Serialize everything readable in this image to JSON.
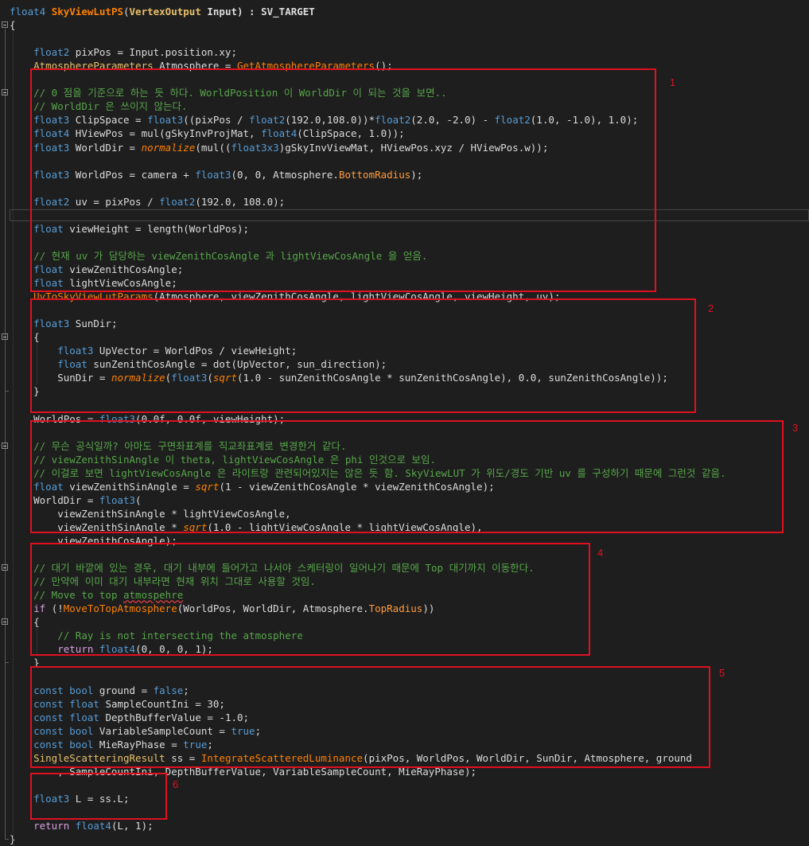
{
  "editor": {
    "lines": [
      {
        "spans": [
          [
            "float4",
            "type"
          ],
          [
            " ",
            ""
          ],
          [
            "SkyViewLutPS",
            "fn"
          ],
          [
            "(",
            ""
          ],
          [
            "VertexOutput",
            "struct"
          ],
          [
            " Input) : SV_TARGET",
            ""
          ]
        ]
      },
      {
        "spans": [
          [
            "{",
            ""
          ]
        ]
      },
      {
        "spans": [
          [
            "",
            ""
          ]
        ]
      },
      {
        "spans": [
          [
            "    ",
            ""
          ],
          [
            "float2",
            "type"
          ],
          [
            " pixPos = Input.position.xy;",
            ""
          ]
        ]
      },
      {
        "spans": [
          [
            "    ",
            ""
          ],
          [
            "AtmosphereParameters",
            "struct"
          ],
          [
            " Atmosphere = ",
            ""
          ],
          [
            "GetAtmosphereParameters",
            "fn"
          ],
          [
            "();",
            ""
          ]
        ]
      },
      {
        "spans": [
          [
            "",
            ""
          ]
        ]
      },
      {
        "spans": [
          [
            "    ",
            ""
          ],
          [
            "// 0 점을 기준으로 하는 듯 하다. WorldPosition 이 WorldDir 이 되는 것을 보면..",
            "cmt"
          ]
        ]
      },
      {
        "spans": [
          [
            "    ",
            ""
          ],
          [
            "// WorldDir 은 쓰이지 않는다.",
            "cmt"
          ]
        ]
      },
      {
        "spans": [
          [
            "    ",
            ""
          ],
          [
            "float3",
            "type"
          ],
          [
            " ClipSpace = ",
            ""
          ],
          [
            "float3",
            "type"
          ],
          [
            "((pixPos / ",
            ""
          ],
          [
            "float2",
            "type"
          ],
          [
            "(192.0,108.0))*",
            ""
          ],
          [
            "float2",
            "type"
          ],
          [
            "(2.0, -2.0) - ",
            ""
          ],
          [
            "float2",
            "type"
          ],
          [
            "(1.0, -1.0), 1.0);",
            ""
          ]
        ]
      },
      {
        "spans": [
          [
            "    ",
            ""
          ],
          [
            "float4",
            "type"
          ],
          [
            " HViewPos = mul(gSkyInvProjMat, ",
            ""
          ],
          [
            "float4",
            "type"
          ],
          [
            "(ClipSpace, 1.0));",
            ""
          ]
        ]
      },
      {
        "spans": [
          [
            "    ",
            ""
          ],
          [
            "float3",
            "type"
          ],
          [
            " WorldDir = ",
            ""
          ],
          [
            "normalize",
            "ital"
          ],
          [
            "(mul((",
            ""
          ],
          [
            "float3x3",
            "type"
          ],
          [
            ")gSkyInvViewMat, HViewPos.xyz / HViewPos.w));",
            ""
          ]
        ]
      },
      {
        "spans": [
          [
            "",
            ""
          ]
        ]
      },
      {
        "spans": [
          [
            "    ",
            ""
          ],
          [
            "float3",
            "type"
          ],
          [
            " WorldPos = camera + ",
            ""
          ],
          [
            "float3",
            "type"
          ],
          [
            "(0, 0, Atmosphere.",
            ""
          ],
          [
            "BottomRadius",
            "field"
          ],
          [
            ");",
            ""
          ]
        ]
      },
      {
        "spans": [
          [
            "",
            ""
          ]
        ]
      },
      {
        "spans": [
          [
            "    ",
            ""
          ],
          [
            "float2",
            "type"
          ],
          [
            " uv = pixPos / ",
            ""
          ],
          [
            "float2",
            "type"
          ],
          [
            "(192.0, 108.0);",
            ""
          ]
        ]
      },
      {
        "spans": [
          [
            "",
            ""
          ]
        ]
      },
      {
        "spans": [
          [
            "    ",
            ""
          ],
          [
            "float",
            "type"
          ],
          [
            " viewHeight = length(WorldPos);",
            ""
          ]
        ]
      },
      {
        "spans": [
          [
            "",
            ""
          ]
        ]
      },
      {
        "spans": [
          [
            "    ",
            ""
          ],
          [
            "// 현재 uv 가 담당하는 viewZenithCosAngle 과 lightViewCosAngle 을 얻음.",
            "cmt"
          ]
        ]
      },
      {
        "spans": [
          [
            "    ",
            ""
          ],
          [
            "float",
            "type"
          ],
          [
            " viewZenithCosAngle;",
            ""
          ]
        ]
      },
      {
        "spans": [
          [
            "    ",
            ""
          ],
          [
            "float",
            "type"
          ],
          [
            " lightViewCosAngle;",
            ""
          ]
        ]
      },
      {
        "spans": [
          [
            "    ",
            ""
          ],
          [
            "UvToSkyViewLutParams",
            "fn"
          ],
          [
            "(Atmosphere, viewZenithCosAngle, lightViewCosAngle, viewHeight, uv);",
            ""
          ]
        ]
      },
      {
        "spans": [
          [
            "",
            ""
          ]
        ]
      },
      {
        "spans": [
          [
            "    ",
            ""
          ],
          [
            "float3",
            "type"
          ],
          [
            " SunDir;",
            ""
          ]
        ]
      },
      {
        "spans": [
          [
            "    {",
            ""
          ]
        ]
      },
      {
        "spans": [
          [
            "        ",
            ""
          ],
          [
            "float3",
            "type"
          ],
          [
            " UpVector = WorldPos / viewHeight;",
            ""
          ]
        ]
      },
      {
        "spans": [
          [
            "        ",
            ""
          ],
          [
            "float",
            "type"
          ],
          [
            " sunZenithCosAngle = dot(UpVector, sun_direction);",
            ""
          ]
        ]
      },
      {
        "spans": [
          [
            "        SunDir = ",
            ""
          ],
          [
            "normalize",
            "ital"
          ],
          [
            "(",
            ""
          ],
          [
            "float3",
            "type"
          ],
          [
            "(",
            ""
          ],
          [
            "sqrt",
            "ital"
          ],
          [
            "(1.0 - sunZenithCosAngle * sunZenithCosAngle), 0.0, sunZenithCosAngle));",
            ""
          ]
        ]
      },
      {
        "spans": [
          [
            "    }",
            ""
          ]
        ]
      },
      {
        "spans": [
          [
            "",
            ""
          ]
        ]
      },
      {
        "spans": [
          [
            "    WorldPos = ",
            ""
          ],
          [
            "float3",
            "type"
          ],
          [
            "(0.0f, 0.0f, viewHeight);",
            ""
          ]
        ]
      },
      {
        "spans": [
          [
            "",
            ""
          ]
        ]
      },
      {
        "spans": [
          [
            "    ",
            ""
          ],
          [
            "// 무슨 공식일까? 아마도 구면좌표계를 직교좌표계로 변경한거 같다.",
            "cmt"
          ]
        ]
      },
      {
        "spans": [
          [
            "    ",
            ""
          ],
          [
            "// viewZenithSinAngle 이 theta, lightViewCosAngle 은 phi 인것으로 보임.",
            "cmt"
          ]
        ]
      },
      {
        "spans": [
          [
            "    ",
            ""
          ],
          [
            "// 이걸로 보면 lightViewCosAngle 은 라이트랑 관련되어있지는 않은 듯 함. SkyViewLUT 가 위도/경도 기반 uv 를 구성하기 때문에 그런것 같음.",
            "cmt"
          ]
        ]
      },
      {
        "spans": [
          [
            "    ",
            ""
          ],
          [
            "float",
            "type"
          ],
          [
            " viewZenithSinAngle = ",
            ""
          ],
          [
            "sqrt",
            "ital"
          ],
          [
            "(1 - viewZenithCosAngle * viewZenithCosAngle);",
            ""
          ]
        ]
      },
      {
        "spans": [
          [
            "    WorldDir = ",
            ""
          ],
          [
            "float3",
            "type"
          ],
          [
            "(",
            ""
          ]
        ]
      },
      {
        "spans": [
          [
            "        viewZenithSinAngle * lightViewCosAngle,",
            ""
          ]
        ]
      },
      {
        "spans": [
          [
            "        viewZenithSinAngle * ",
            ""
          ],
          [
            "sqrt",
            "ital"
          ],
          [
            "(1.0 - lightViewCosAngle * lightViewCosAngle),",
            ""
          ]
        ]
      },
      {
        "spans": [
          [
            "        viewZenithCosAngle);",
            ""
          ]
        ]
      },
      {
        "spans": [
          [
            "",
            ""
          ]
        ]
      },
      {
        "spans": [
          [
            "    ",
            ""
          ],
          [
            "// 대기 바깥에 있는 경우, 대기 내부에 들어가고 나서야 스케터링이 일어나기 때문에 Top 대기까지 이동한다.",
            "cmt"
          ]
        ]
      },
      {
        "spans": [
          [
            "    ",
            ""
          ],
          [
            "// 만약에 이미 대기 내부라면 현재 위치 그대로 사용할 것임.",
            "cmt"
          ]
        ]
      },
      {
        "spans": [
          [
            "    ",
            ""
          ],
          [
            "// Move to top ",
            "cmt"
          ],
          [
            "atmospehre",
            "cmt-sq"
          ]
        ]
      },
      {
        "spans": [
          [
            "    ",
            ""
          ],
          [
            "if",
            "ctl"
          ],
          [
            " (!",
            ""
          ],
          [
            "MoveToTopAtmosphere",
            "fn"
          ],
          [
            "(WorldPos, WorldDir, Atmosphere.",
            ""
          ],
          [
            "TopRadius",
            "field"
          ],
          [
            "))",
            ""
          ]
        ]
      },
      {
        "spans": [
          [
            "    {",
            ""
          ]
        ]
      },
      {
        "spans": [
          [
            "        ",
            ""
          ],
          [
            "// Ray is not intersecting the atmosphere",
            "cmt"
          ]
        ]
      },
      {
        "spans": [
          [
            "        ",
            ""
          ],
          [
            "return",
            "ctl"
          ],
          [
            " ",
            ""
          ],
          [
            "float4",
            "type"
          ],
          [
            "(0, 0, 0, 1);",
            ""
          ]
        ]
      },
      {
        "spans": [
          [
            "    }",
            ""
          ]
        ]
      },
      {
        "spans": [
          [
            "",
            ""
          ]
        ]
      },
      {
        "spans": [
          [
            "    ",
            ""
          ],
          [
            "const",
            "kw"
          ],
          [
            " ",
            ""
          ],
          [
            "bool",
            "kw"
          ],
          [
            " ground = ",
            ""
          ],
          [
            "false",
            "kw"
          ],
          [
            ";",
            ""
          ]
        ]
      },
      {
        "spans": [
          [
            "    ",
            ""
          ],
          [
            "const",
            "kw"
          ],
          [
            " ",
            ""
          ],
          [
            "float",
            "type"
          ],
          [
            " SampleCountIni = 30;",
            ""
          ]
        ]
      },
      {
        "spans": [
          [
            "    ",
            ""
          ],
          [
            "const",
            "kw"
          ],
          [
            " ",
            ""
          ],
          [
            "float",
            "type"
          ],
          [
            " DepthBufferValue = -1.0;",
            ""
          ]
        ]
      },
      {
        "spans": [
          [
            "    ",
            ""
          ],
          [
            "const",
            "kw"
          ],
          [
            " ",
            ""
          ],
          [
            "bool",
            "kw"
          ],
          [
            " VariableSampleCount = ",
            ""
          ],
          [
            "true",
            "kw"
          ],
          [
            ";",
            ""
          ]
        ]
      },
      {
        "spans": [
          [
            "    ",
            ""
          ],
          [
            "const",
            "kw"
          ],
          [
            " ",
            ""
          ],
          [
            "bool",
            "kw"
          ],
          [
            " MieRayPhase = ",
            ""
          ],
          [
            "true",
            "kw"
          ],
          [
            ";",
            ""
          ]
        ]
      },
      {
        "spans": [
          [
            "    ",
            ""
          ],
          [
            "SingleScatteringResult",
            "struct"
          ],
          [
            " ss = ",
            ""
          ],
          [
            "IntegrateScatteredLuminance",
            "fn"
          ],
          [
            "(pixPos, WorldPos, WorldDir, SunDir, Atmosphere, ground",
            ""
          ]
        ]
      },
      {
        "spans": [
          [
            "        , SampleCountIni, DepthBufferValue, VariableSampleCount, MieRayPhase);",
            ""
          ]
        ]
      },
      {
        "spans": [
          [
            "",
            ""
          ]
        ]
      },
      {
        "spans": [
          [
            "    ",
            ""
          ],
          [
            "float3",
            "type"
          ],
          [
            " L = ss.L;",
            ""
          ]
        ]
      },
      {
        "spans": [
          [
            "",
            ""
          ]
        ]
      },
      {
        "spans": [
          [
            "    ",
            ""
          ],
          [
            "return",
            "ctl"
          ],
          [
            " ",
            ""
          ],
          [
            "float4",
            "type"
          ],
          [
            "(L, 1);",
            ""
          ]
        ]
      },
      {
        "spans": [
          [
            "}",
            ""
          ]
        ]
      }
    ]
  },
  "annotations": {
    "labels": [
      "1",
      "2",
      "3",
      "4",
      "5",
      "6"
    ],
    "color": "#e01020"
  },
  "colors": {
    "background": "#1e1e1e",
    "type": "#569cd6",
    "comment": "#57a64a",
    "function": "#ff8000",
    "struct": "#e8c06a",
    "control": "#d8a0df"
  }
}
